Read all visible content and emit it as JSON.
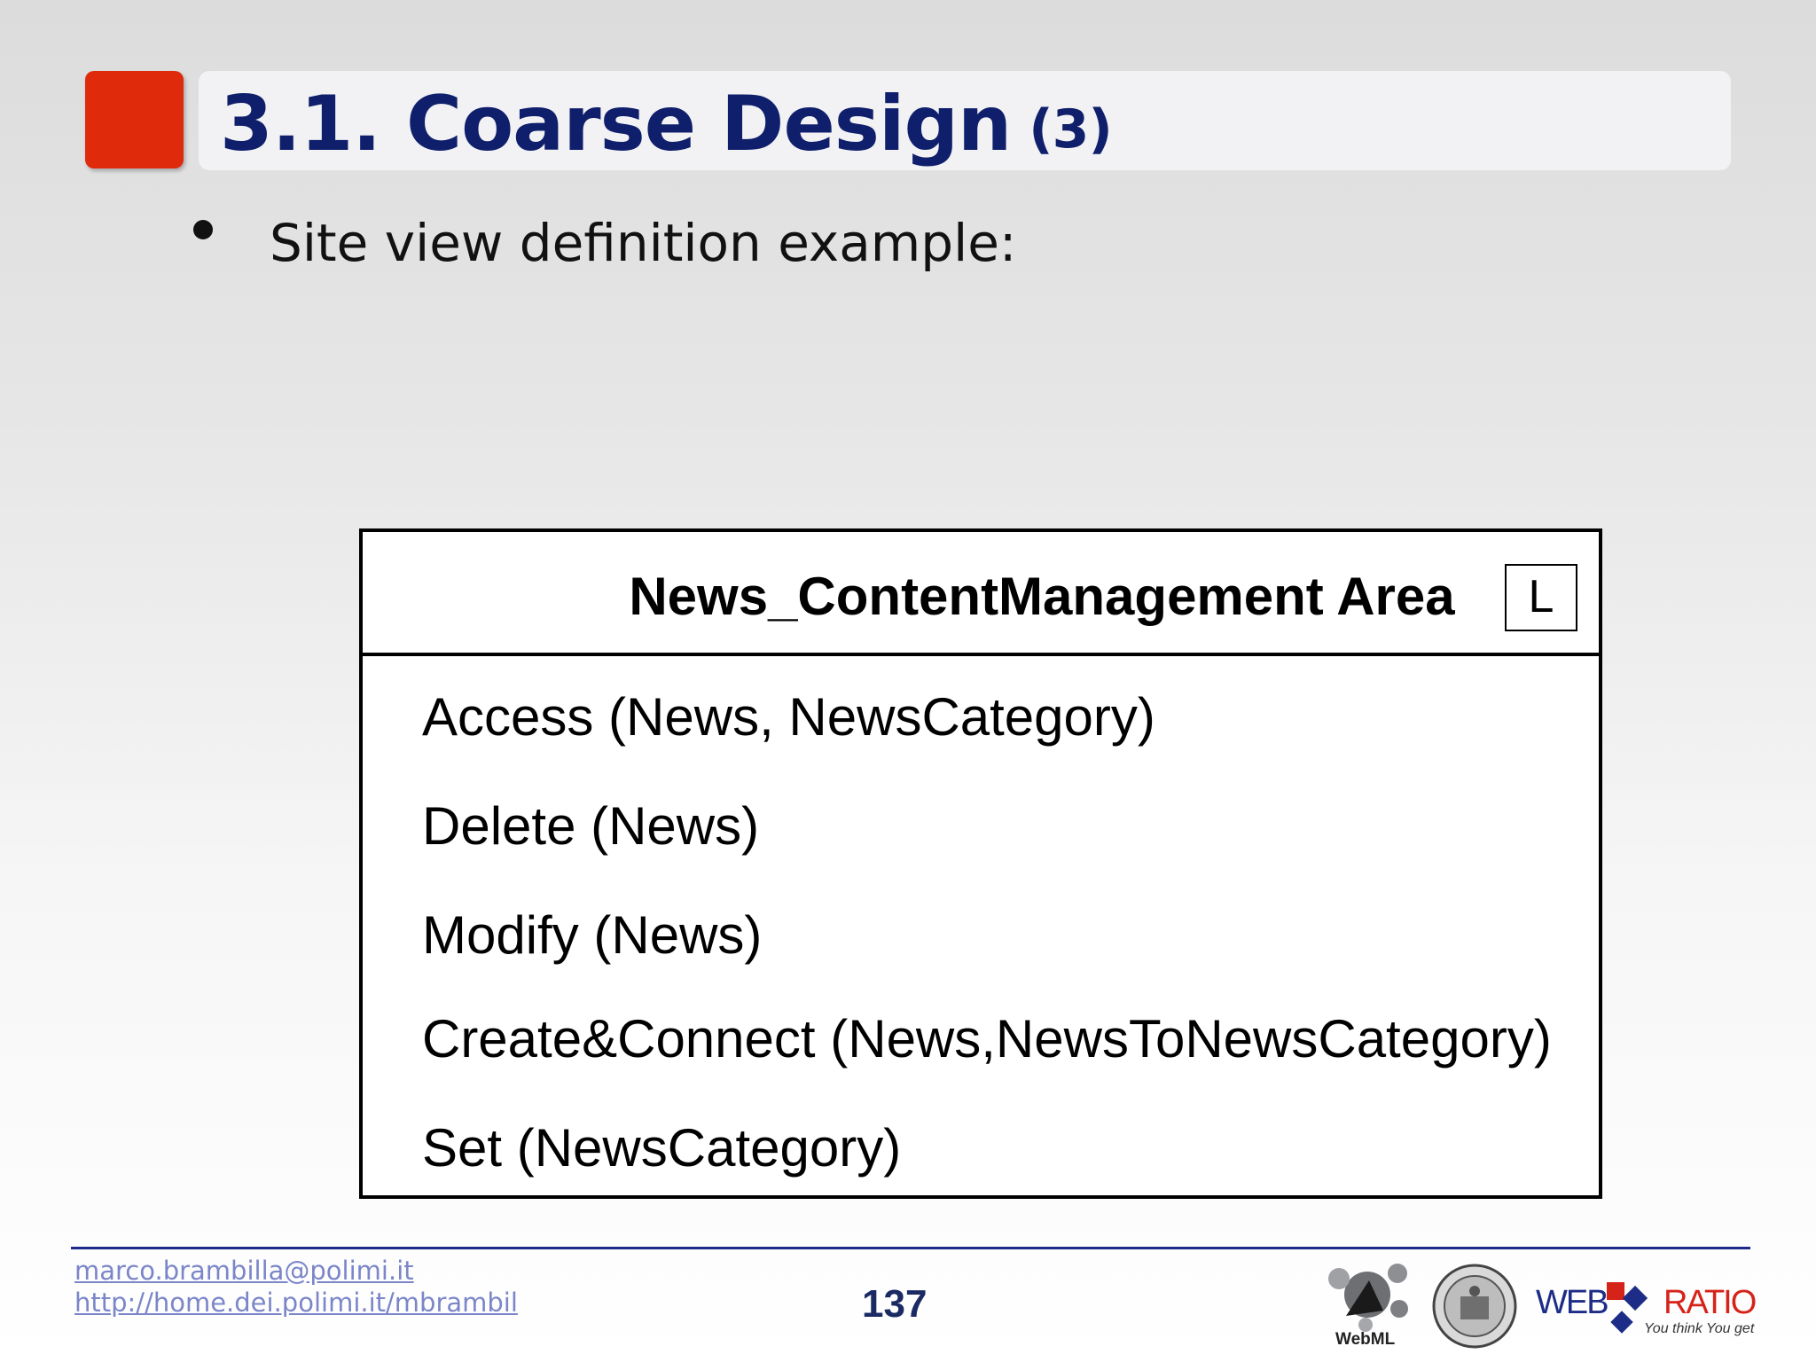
{
  "slide": {
    "title": "3.1. Coarse Design",
    "title_suffix": "(3)",
    "bullet": "Site view definition example:"
  },
  "area": {
    "title": "News_ContentManagement Area",
    "landmark": "L",
    "operations": [
      "Access (News, NewsCategory)",
      "Delete (News)",
      "Modify (News)",
      "Create&Connect (News,NewsToNewsCategory)",
      "Set (NewsCategory)"
    ]
  },
  "footer": {
    "email": "marco.brambilla@polimi.it",
    "url": "http://home.dei.polimi.it/mbrambil",
    "page_number": "137",
    "webml_label": "WebML",
    "webratio_web": "WEB",
    "webratio_ratio": "RATIO",
    "webratio_tagline": "You think You get"
  },
  "colors": {
    "accent_red": "#e02a0c",
    "title_blue": "#0f1f6b",
    "link": "#7b86c9"
  }
}
